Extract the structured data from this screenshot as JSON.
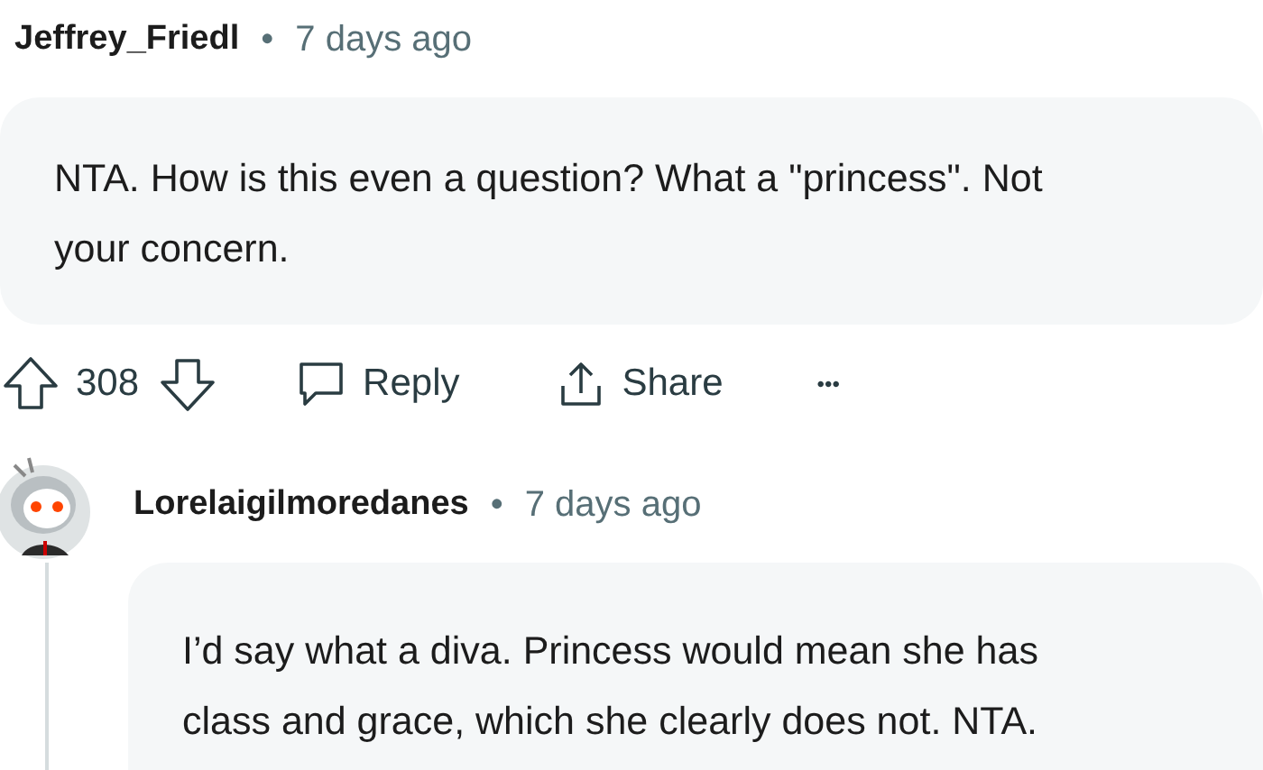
{
  "comments": [
    {
      "author": "Jeffrey_Friedl",
      "separator": "•",
      "time": "7 days ago",
      "has_avatar": false,
      "body_lines": [
        "NTA. How is this even a question? What a \"princess\". Not",
        "your concern."
      ],
      "actions": {
        "score": "308",
        "reply": "Reply",
        "share": "Share",
        "more": "•••"
      }
    },
    {
      "author": "Lorelaigilmoredanes",
      "separator": "•",
      "time": "7 days ago",
      "has_avatar": true,
      "body_lines": [
        "I’d say what a diva. Princess would mean she has",
        "class and grace, which she clearly does not. NTA."
      ]
    }
  ]
}
